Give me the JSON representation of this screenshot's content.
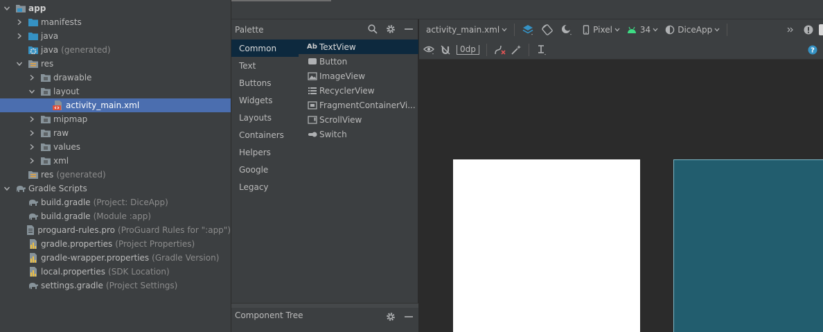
{
  "project_tree": [
    {
      "label": "app",
      "hint": "",
      "level": 0,
      "expanded": true,
      "icon": "module-folder-icon",
      "bold": true
    },
    {
      "label": "manifests",
      "hint": "",
      "level": 1,
      "expanded": false,
      "icon": "folder-icon"
    },
    {
      "label": "java",
      "hint": "",
      "level": 1,
      "expanded": false,
      "icon": "folder-icon"
    },
    {
      "label": "java",
      "hint": "(generated)",
      "level": 1,
      "expanded": null,
      "icon": "generated-folder-icon"
    },
    {
      "label": "res",
      "hint": "",
      "level": 1,
      "expanded": true,
      "icon": "res-folder-icon"
    },
    {
      "label": "drawable",
      "hint": "",
      "level": 2,
      "expanded": false,
      "icon": "package-folder-icon"
    },
    {
      "label": "layout",
      "hint": "",
      "level": 2,
      "expanded": true,
      "icon": "package-folder-icon"
    },
    {
      "label": "activity_main.xml",
      "hint": "",
      "level": 3,
      "expanded": null,
      "icon": "xml-layout-file-icon",
      "selected": true
    },
    {
      "label": "mipmap",
      "hint": "",
      "level": 2,
      "expanded": false,
      "icon": "package-folder-icon"
    },
    {
      "label": "raw",
      "hint": "",
      "level": 2,
      "expanded": false,
      "icon": "package-folder-icon"
    },
    {
      "label": "values",
      "hint": "",
      "level": 2,
      "expanded": false,
      "icon": "package-folder-icon"
    },
    {
      "label": "xml",
      "hint": "",
      "level": 2,
      "expanded": false,
      "icon": "package-folder-icon"
    },
    {
      "label": "res",
      "hint": "(generated)",
      "level": 1,
      "expanded": null,
      "icon": "res-folder-icon"
    },
    {
      "label": "Gradle Scripts",
      "hint": "",
      "level": 0,
      "expanded": true,
      "icon": "gradle-elephant-icon"
    },
    {
      "label": "build.gradle",
      "hint": "(Project: DiceApp)",
      "level": 1,
      "expanded": null,
      "icon": "gradle-elephant-icon"
    },
    {
      "label": "build.gradle",
      "hint": "(Module :app)",
      "level": 1,
      "expanded": null,
      "icon": "gradle-elephant-icon"
    },
    {
      "label": "proguard-rules.pro",
      "hint": "(ProGuard Rules for \":app\")",
      "level": 1,
      "expanded": null,
      "icon": "text-file-icon"
    },
    {
      "label": "gradle.properties",
      "hint": "(Project Properties)",
      "level": 1,
      "expanded": null,
      "icon": "properties-file-icon"
    },
    {
      "label": "gradle-wrapper.properties",
      "hint": "(Gradle Version)",
      "level": 1,
      "expanded": null,
      "icon": "properties-file-icon"
    },
    {
      "label": "local.properties",
      "hint": "(SDK Location)",
      "level": 1,
      "expanded": null,
      "icon": "properties-file-icon"
    },
    {
      "label": "settings.gradle",
      "hint": "(Project Settings)",
      "level": 1,
      "expanded": null,
      "icon": "gradle-elephant-icon"
    }
  ],
  "palette": {
    "title": "Palette",
    "categories": [
      {
        "label": "Common",
        "active": true
      },
      {
        "label": "Text"
      },
      {
        "label": "Buttons"
      },
      {
        "label": "Widgets"
      },
      {
        "label": "Layouts"
      },
      {
        "label": "Containers"
      },
      {
        "label": "Helpers"
      },
      {
        "label": "Google"
      },
      {
        "label": "Legacy"
      }
    ],
    "widgets": [
      {
        "label": "TextView",
        "icon": "textview-icon",
        "icon_text": "Ab",
        "active": true
      },
      {
        "label": "Button",
        "icon": "button-icon"
      },
      {
        "label": "ImageView",
        "icon": "image-icon"
      },
      {
        "label": "RecyclerView",
        "icon": "list-icon"
      },
      {
        "label": "FragmentContainerVi...",
        "icon": "fragment-icon"
      },
      {
        "label": "ScrollView",
        "icon": "scrollview-icon"
      },
      {
        "label": "Switch",
        "icon": "switch-icon"
      }
    ]
  },
  "component_tree": {
    "title": "Component Tree"
  },
  "toolbar": {
    "file_name": "activity_main.xml",
    "device": "Pixel",
    "api_level": "34",
    "theme": "DiceApp",
    "margin_value": "0dp"
  },
  "colors": {
    "selection": "#4b6eaf",
    "palette_active": "#0d293e",
    "blueprint": "#225d6e",
    "android_green": "#3ddc84",
    "help_blue": "#3592c4"
  }
}
